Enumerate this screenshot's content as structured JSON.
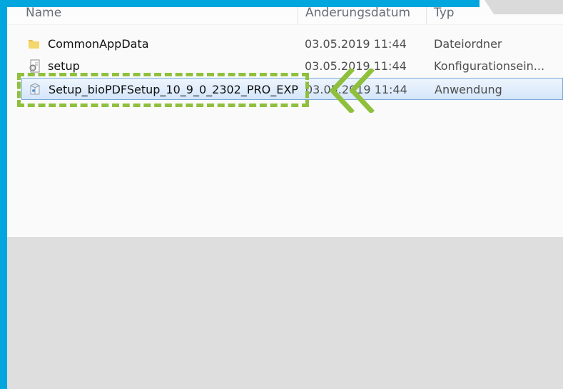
{
  "header": {
    "name": "Name",
    "date": "Änderungsdatum",
    "type": "Typ"
  },
  "files": [
    {
      "name": "CommonAppData",
      "date": "03.05.2019 11:44",
      "type": "Dateiordner",
      "icon": "folder-icon"
    },
    {
      "name": "setup",
      "date": "03.05.2019 11:44",
      "type": "Konfigurationsein...",
      "icon": "settings-file-icon"
    },
    {
      "name": "Setup_bioPDFSetup_10_9_0_2302_PRO_EXP",
      "date": "03.05.2019 11:44",
      "type": "Anwendung",
      "icon": "setup-package-icon",
      "selected": true
    }
  ],
  "colors": {
    "accent": "#00a6dd",
    "highlight": "#8fc03d",
    "selection_border": "#7aa7d7"
  }
}
